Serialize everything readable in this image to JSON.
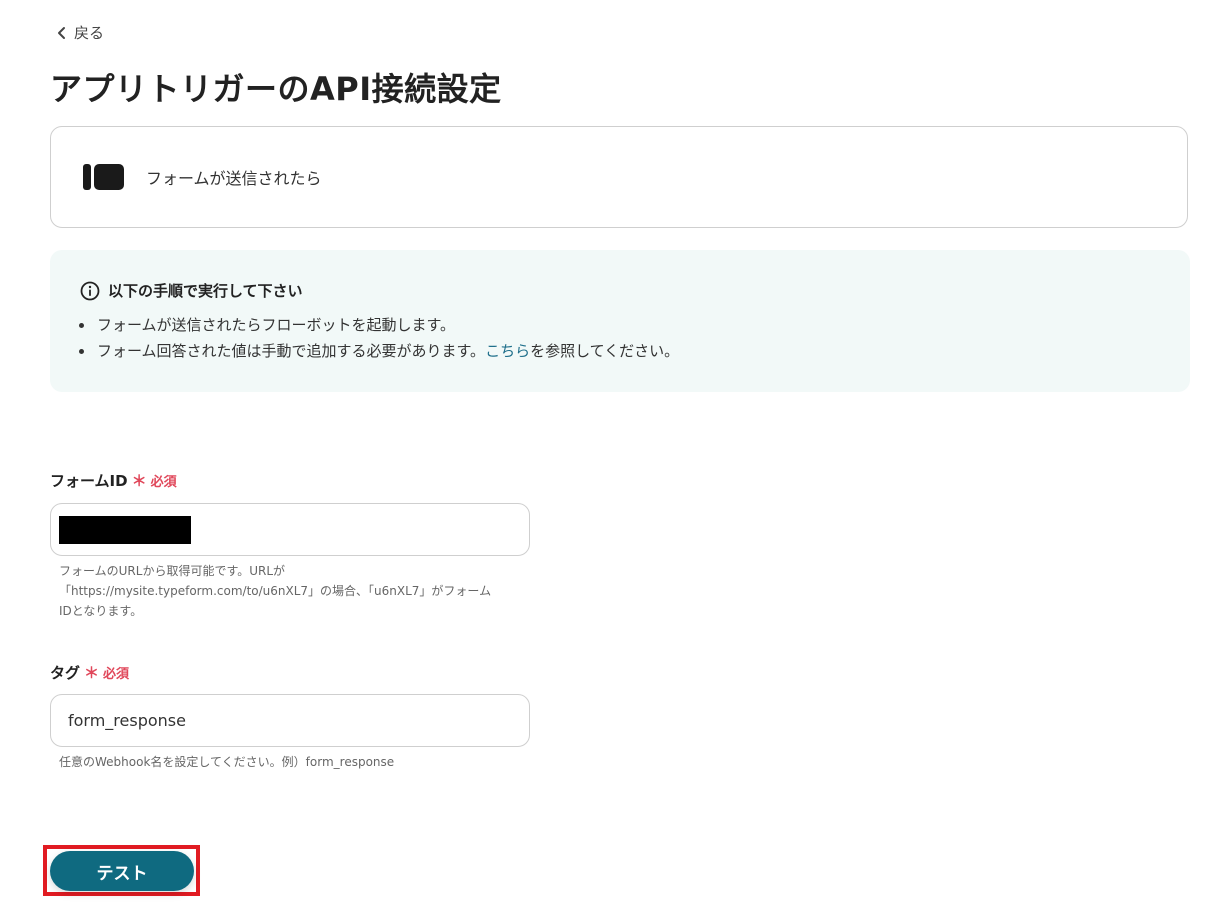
{
  "nav": {
    "back_label": "戻る"
  },
  "page": {
    "title": "アプリトリガーのAPI接続設定"
  },
  "trigger": {
    "label": "フォームが送信されたら"
  },
  "info": {
    "heading": "以下の手順で実行して下さい",
    "item1": "フォームが送信されたらフローボットを起動します。",
    "item2_before": "フォーム回答された値は手動で追加する必要があります。",
    "item2_link": "こちら",
    "item2_after": "を参照してください。"
  },
  "form_id": {
    "label": "フォームID",
    "required_mark": "＊",
    "required_text": "必須",
    "value": "",
    "help_line1": "フォームのURLから取得可能です。URLが",
    "help_line2": "「https://mysite.typeform.com/to/u6nXL7」の場合、「u6nXL7」がフォーム",
    "help_line3": "IDとなります。"
  },
  "tag": {
    "label": "タグ",
    "required_mark": "＊",
    "required_text": "必須",
    "value": "form_response",
    "help": "任意のWebhook名を設定してください。例）form_response"
  },
  "actions": {
    "test_label": "テスト"
  },
  "colors": {
    "primary": "#0f6a80",
    "required": "#e0475a",
    "info_bg": "#f2f9f8",
    "highlight_frame": "#e11b22",
    "link": "#1f6f8b"
  }
}
